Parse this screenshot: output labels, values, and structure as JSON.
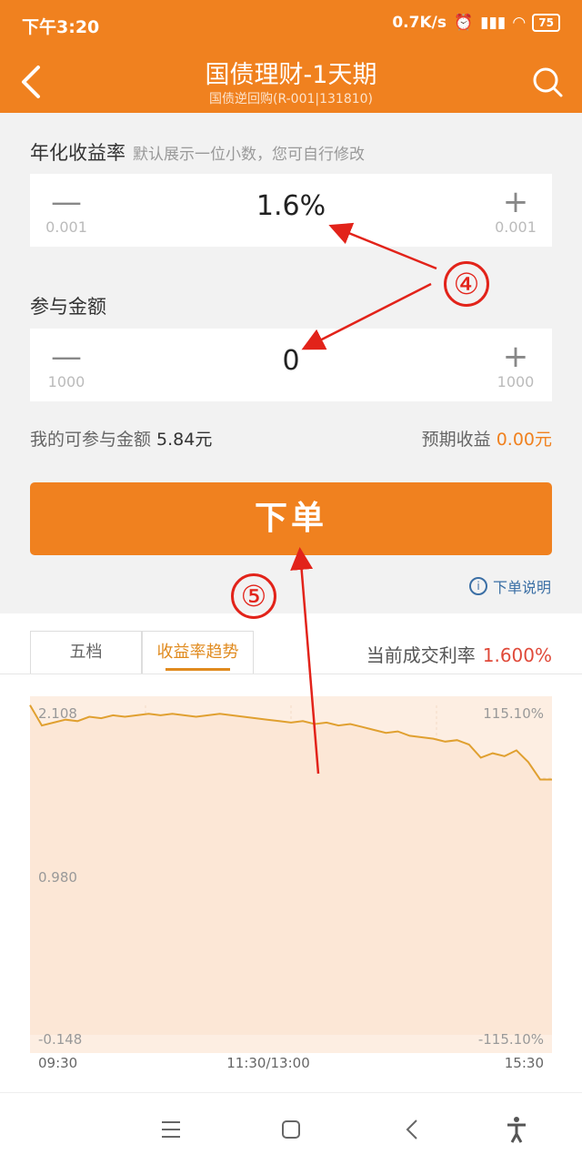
{
  "status_bar": {
    "time": "下午3:20",
    "speed": "0.7K/s",
    "battery": "75"
  },
  "header": {
    "title": "国债理财-1天期",
    "subtitle": "国债逆回购(R-001|131810)"
  },
  "rate_field": {
    "label": "年化收益率",
    "hint": "默认展示一位小数，您可自行修改",
    "value": "1.6%",
    "minus_symbol": "—",
    "plus_symbol": "+",
    "step_minus": "0.001",
    "step_plus": "0.001"
  },
  "amount_field": {
    "label": "参与金额",
    "value": "0",
    "minus_symbol": "—",
    "plus_symbol": "+",
    "step_minus": "1000",
    "step_plus": "1000"
  },
  "info": {
    "available_label": "我的可参与金额",
    "available_value": "5.84元",
    "expected_label": "预期收益",
    "expected_value": "0.00元"
  },
  "order_button": "下单",
  "order_help": "下单说明",
  "tabs": [
    {
      "label": "五档",
      "active": false
    },
    {
      "label": "收益率趋势",
      "active": true
    }
  ],
  "current_rate": {
    "label": "当前成交利率",
    "value": "1.600%"
  },
  "chart_data": {
    "type": "area",
    "y_left_ticks": [
      "2.108",
      "0.980",
      "-0.148"
    ],
    "y_right_ticks": [
      "115.10%",
      "-115.10%"
    ],
    "x_ticks": [
      "09:30",
      "11:30/13:00",
      "15:30"
    ],
    "ylim": [
      -0.148,
      2.108
    ],
    "series": [
      {
        "values": [
          2.11,
          1.97,
          1.99,
          2.01,
          2.0,
          2.03,
          2.02,
          2.04,
          2.03,
          2.04,
          2.05,
          2.04,
          2.05,
          2.04,
          2.03,
          2.04,
          2.05,
          2.04,
          2.03,
          2.02,
          2.01,
          2.0,
          1.99,
          2.0,
          1.98,
          1.99,
          1.97,
          1.98,
          1.96,
          1.94,
          1.92,
          1.93,
          1.9,
          1.89,
          1.88,
          1.86,
          1.87,
          1.84,
          1.75,
          1.78,
          1.76,
          1.8,
          1.72,
          1.6,
          1.6
        ]
      }
    ],
    "colors": {
      "line": "#E0A030",
      "fill": "#FDEEE2"
    }
  },
  "annotations": {
    "label_4": "④",
    "label_5": "⑤"
  }
}
